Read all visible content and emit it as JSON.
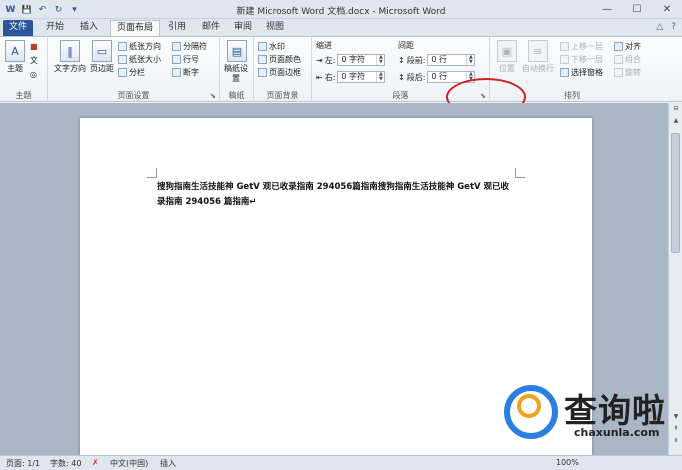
{
  "window": {
    "title": "新建 Microsoft Word 文档.docx - Microsoft Word",
    "controls": {
      "minimize": "—",
      "maximize": "☐",
      "close": "✕"
    }
  },
  "quick_access": {
    "save": "💾",
    "word": "W",
    "undo": "↶",
    "redo": "↻",
    "customize": "▾"
  },
  "tabs": [
    {
      "label": "文件"
    },
    {
      "label": "开始"
    },
    {
      "label": "插入"
    },
    {
      "label": "页面布局"
    },
    {
      "label": "引用"
    },
    {
      "label": "邮件"
    },
    {
      "label": "审阅"
    },
    {
      "label": "视图"
    }
  ],
  "tab_right": {
    "minimize_ribbon": "△",
    "help": "?"
  },
  "ribbon": {
    "themes": {
      "group": "主题",
      "theme_btn": "主题",
      "colors": "■",
      "fonts": "文",
      "effects": "◎"
    },
    "page_setup": {
      "group": "页面设置",
      "text_direction": "文字方向",
      "margins": "页边距",
      "orientation": "纸张方向",
      "size": "纸张大小",
      "columns": "分栏",
      "breaks": "分隔符",
      "line_numbers": "行号",
      "hyphenation": "断字"
    },
    "draft_paper": {
      "group": "稿纸",
      "btn": "稿纸设置"
    },
    "page_background": {
      "group": "页面背景",
      "watermark": "水印",
      "page_color": "页面颜色",
      "page_borders": "页面边框"
    },
    "paragraph": {
      "group": "段落",
      "indent_title": "缩进",
      "indent_left_label": "左:",
      "indent_left_value": "0 字符",
      "indent_right_label": "右:",
      "indent_right_value": "0 字符",
      "spacing_title": "间距",
      "before_label": "段前:",
      "before_value": "0 行",
      "after_label": "段后:",
      "after_value": "0 行"
    },
    "arrange": {
      "group": "排列",
      "position": "位置",
      "wrap_text": "自动换行",
      "bring_forward": "上移一层",
      "send_backward": "下移一层",
      "selection_pane": "选择窗格",
      "align": "对齐",
      "group_btn": "组合",
      "rotate": "旋转"
    }
  },
  "document": {
    "body": "搜狗指南生活技能神  GetV 观已收录指南 294056篇指南搜狗指南生活技能神  GetV 观已收录指南 294056 篇指南↵"
  },
  "statusbar": {
    "page": "页面: 1/1",
    "words": "字数: 40",
    "language": "中文(中国)",
    "mode": "插入",
    "zoom": "100%"
  },
  "watermark": {
    "cn": "查询啦",
    "url": "chaxunla.com"
  },
  "colors": {
    "accent": "#2b579a",
    "annotation": "#d21f1f",
    "logo_blue": "#2a7fe0",
    "logo_orange": "#f2a21c"
  }
}
